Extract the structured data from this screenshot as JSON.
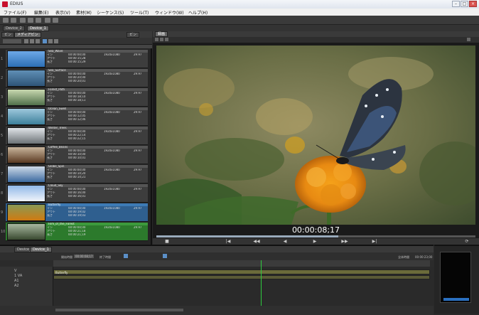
{
  "app": {
    "title": "EDIUS"
  },
  "menu": [
    "ファイル(F)",
    "編集(E)",
    "表示(V)",
    "素材(M)",
    "シーケンス(S)",
    "ツール(T)",
    "ウィンドウ(W)",
    "ヘルプ(H)"
  ],
  "project_tabs": [
    "Device_2",
    "Device_1"
  ],
  "bin": {
    "tabs": [
      "ビン",
      "メディアビン"
    ],
    "right_label": "ビン",
    "search_placeholder": "",
    "clips": [
      {
        "index": "1",
        "name": "Sea_Wave",
        "tc_in": "00:00:00;00",
        "tc_out": "00:00:15;28",
        "dur": "00:00:15;29",
        "fmt": "1920x1080",
        "fps": "29.97",
        "state": "normal",
        "thumb": "sky"
      },
      {
        "index": "2",
        "name": "Sea_Surface",
        "tc_in": "00:00:00;00",
        "tc_out": "00:00:20;00",
        "dur": "00:00:20;01",
        "fmt": "1920x1080",
        "fps": "29.97",
        "state": "normal",
        "thumb": "water"
      },
      {
        "index": "3",
        "name": "Forest_Path",
        "tc_in": "00:00:00;00",
        "tc_out": "00:00:18;10",
        "dur": "00:00:18;11",
        "fmt": "1920x1080",
        "fps": "29.97",
        "state": "normal",
        "thumb": "forest"
      },
      {
        "index": "4",
        "name": "Ocean_Swell",
        "tc_in": "00:00:00;00",
        "tc_out": "00:00:12;05",
        "dur": "00:00:12;06",
        "fmt": "1920x1080",
        "fps": "29.97",
        "state": "normal",
        "thumb": "wave"
      },
      {
        "index": "5",
        "name": "Winter_Trees",
        "tc_in": "00:00:00;00",
        "tc_out": "00:00:22;14",
        "dur": "00:00:22;15",
        "fmt": "1920x1080",
        "fps": "29.97",
        "state": "normal",
        "thumb": "trees"
      },
      {
        "index": "6",
        "name": "Coffee_Beans",
        "tc_in": "00:00:00;00",
        "tc_out": "00:00:10;00",
        "dur": "00:00:10;01",
        "fmt": "1920x1080",
        "fps": "29.97",
        "state": "normal",
        "thumb": "beans"
      },
      {
        "index": "7",
        "name": "Globe_Spin",
        "tc_in": "00:00:00;00",
        "tc_out": "00:00:14;20",
        "dur": "00:00:14;21",
        "fmt": "1920x1080",
        "fps": "29.97",
        "state": "normal",
        "thumb": "globe"
      },
      {
        "index": "8",
        "name": "Cloud_Sky",
        "tc_in": "00:00:00;00",
        "tc_out": "00:00:16;00",
        "dur": "00:00:16;01",
        "fmt": "1920x1080",
        "fps": "29.97",
        "state": "normal",
        "thumb": "clouds"
      },
      {
        "index": "9",
        "name": "Butterfly",
        "tc_in": "00:00:00;00",
        "tc_out": "00:00:19;02",
        "dur": "00:00:19;03",
        "fmt": "1920x1080",
        "fps": "29.97",
        "state": "blue",
        "thumb": "butterfly"
      },
      {
        "index": "10",
        "name": "Film_of_the_Forest",
        "tc_in": "00:00:00;00",
        "tc_out": "00:00:21;18",
        "dur": "00:00:21;19",
        "fmt": "1920x1080",
        "fps": "29.97",
        "state": "green",
        "thumb": "film"
      }
    ],
    "row_labels": [
      "イン",
      "アウト",
      "長さ"
    ]
  },
  "viewer": {
    "tab_label": "録画",
    "timecode": "00:00:08;17",
    "progress": 0.57,
    "transport": [
      "■",
      "|◀",
      "◀◀",
      "◀",
      "▶",
      "▶▶",
      "▶|",
      "⟳"
    ]
  },
  "timeline": {
    "tabs": [
      "Device_2",
      "Device_1"
    ],
    "in_label": "開始時間",
    "in_value": "00:00:08;17",
    "out_label": "終了時間",
    "total_label": "全体時間",
    "total_value": "00:00:23;00",
    "tracks": [
      "V",
      "1 VA",
      "A1",
      "A2"
    ],
    "clip_label": "Butterfly"
  },
  "colors": {
    "accent": "#3d7ab5",
    "playhead": "#2ecc40",
    "record_red": "#c8102e"
  }
}
